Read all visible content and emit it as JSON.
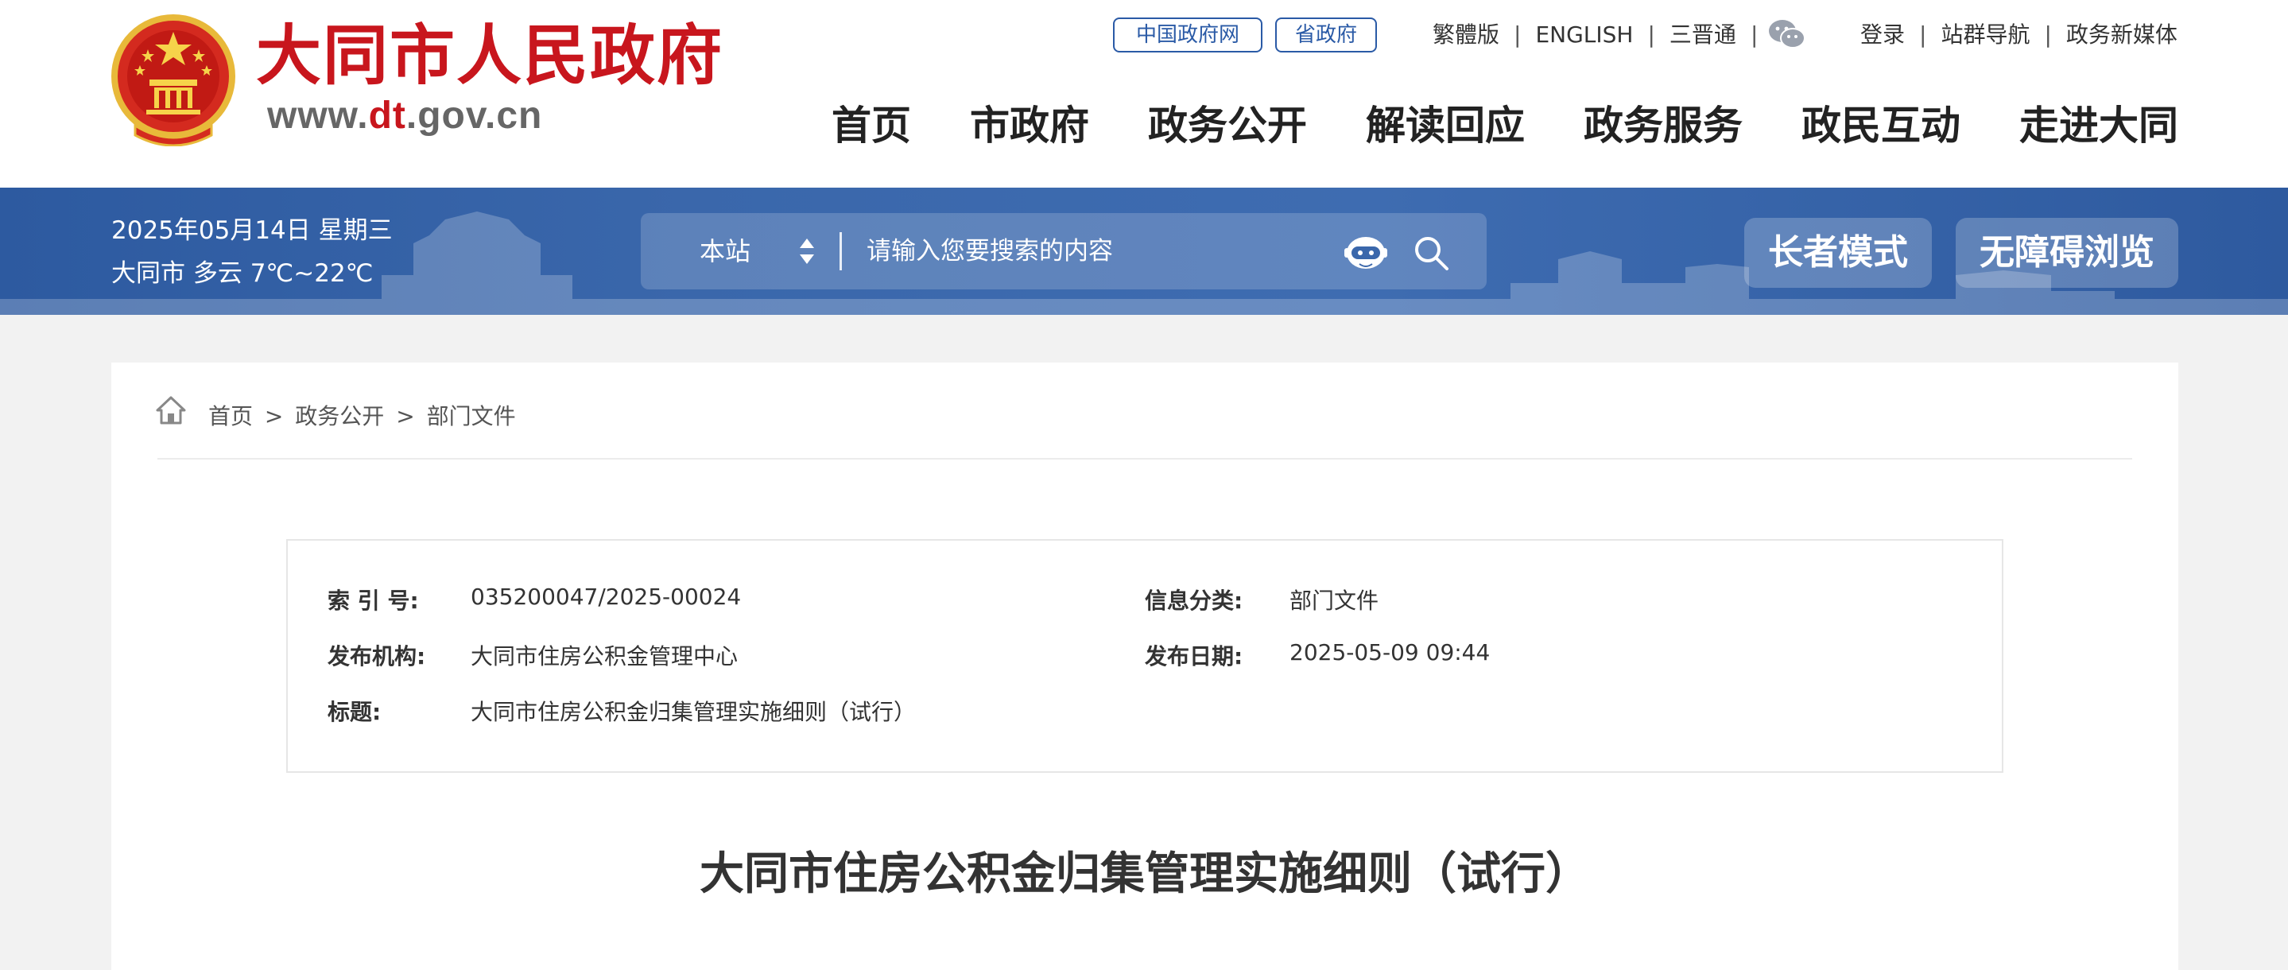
{
  "header": {
    "site_title": "大同市人民政府",
    "site_url_prefix": "www.",
    "site_url_red": "dt",
    "site_url_suffix": ".gov.cn",
    "gov_links": [
      "中国政府网",
      "省政府"
    ],
    "lang_links": [
      "繁體版",
      "ENGLISH",
      "三晋通"
    ],
    "user_links": [
      "登录",
      "站群导航",
      "政务新媒体"
    ],
    "separator": "|",
    "nav": [
      "首页",
      "市政府",
      "政务公开",
      "解读回应",
      "政务服务",
      "政民互动",
      "走进大同"
    ],
    "brand_color": "#c8161d",
    "link_color": "#2a5aa6"
  },
  "bluebar": {
    "date": "2025年05月14日  星期三",
    "weather": "大同市  多云  7℃~22℃",
    "search_scope": "本站",
    "search_placeholder": "请输入您要搜索的内容",
    "elder_mode": "长者模式",
    "accessible": "无障碍浏览",
    "bar_color": "#3a67ab"
  },
  "breadcrumb": {
    "items": [
      "首页",
      "政务公开",
      "部门文件"
    ],
    "separator": ">"
  },
  "info": {
    "index_label": "索 引 号:",
    "index_value": "035200047/2025-00024",
    "category_label": "信息分类:",
    "category_value": "部门文件",
    "publisher_label": "发布机构:",
    "publisher_value": "大同市住房公积金管理中心",
    "date_label": "发布日期:",
    "date_value": "2025-05-09 09:44",
    "title_label": "标题:",
    "title_value": "大同市住房公积金归集管理实施细则（试行）"
  },
  "article": {
    "title": "大同市住房公积金归集管理实施细则（试行）"
  },
  "icons": [
    "national-emblem",
    "wechat-icon",
    "robot-icon",
    "search-icon",
    "home-icon",
    "sort-arrows-icon"
  ]
}
